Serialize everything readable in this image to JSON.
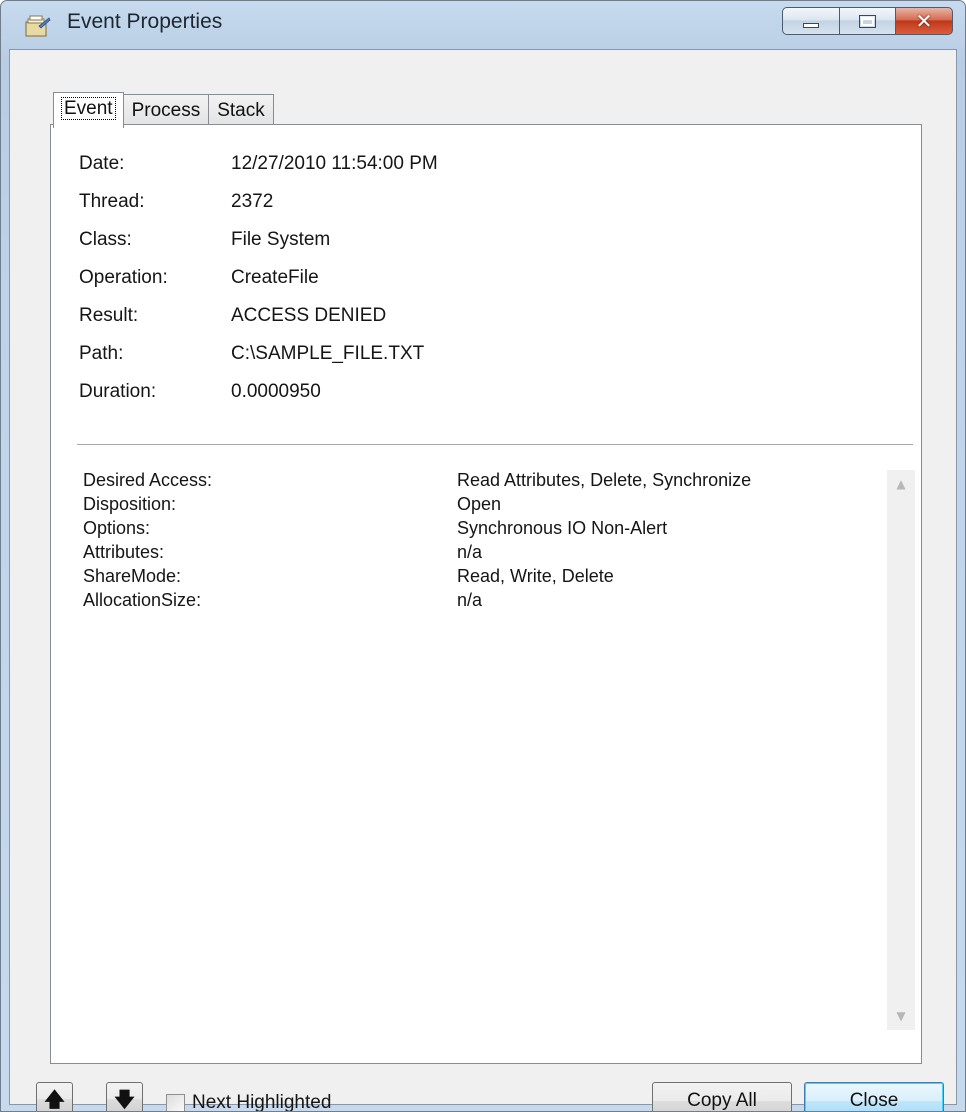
{
  "window": {
    "title": "Event Properties",
    "icon": "event-properties-icon",
    "caption_buttons": [
      "minimize-icon",
      "maximize-icon",
      "close-icon"
    ],
    "close_color": "#c2371a"
  },
  "tabs": [
    {
      "label": "Event",
      "active": true
    },
    {
      "label": "Process",
      "active": false
    },
    {
      "label": "Stack",
      "active": false
    }
  ],
  "properties": [
    {
      "label": "Date:",
      "value": "12/27/2010 11:54:00 PM"
    },
    {
      "label": "Thread:",
      "value": "2372"
    },
    {
      "label": "Class:",
      "value": "File System"
    },
    {
      "label": "Operation:",
      "value": "CreateFile"
    },
    {
      "label": "Result:",
      "value": "ACCESS DENIED"
    },
    {
      "label": "Path:",
      "value": "C:\\SAMPLE_FILE.TXT"
    },
    {
      "label": "Duration:",
      "value": "0.0000950"
    }
  ],
  "details": [
    {
      "label": "Desired Access:",
      "value": "Read Attributes, Delete, Synchronize"
    },
    {
      "label": "Disposition:",
      "value": "Open"
    },
    {
      "label": "Options:",
      "value": "Synchronous IO Non-Alert"
    },
    {
      "label": "Attributes:",
      "value": "n/a"
    },
    {
      "label": "ShareMode:",
      "value": "Read, Write, Delete"
    },
    {
      "label": "AllocationSize:",
      "value": "n/a"
    }
  ],
  "footer": {
    "prev_icon": "arrow-up-icon",
    "next_icon": "arrow-down-icon",
    "next_highlighted_label": "Next Highlighted",
    "next_highlighted_checked": false,
    "copy_all_label": "Copy All",
    "close_label": "Close"
  }
}
